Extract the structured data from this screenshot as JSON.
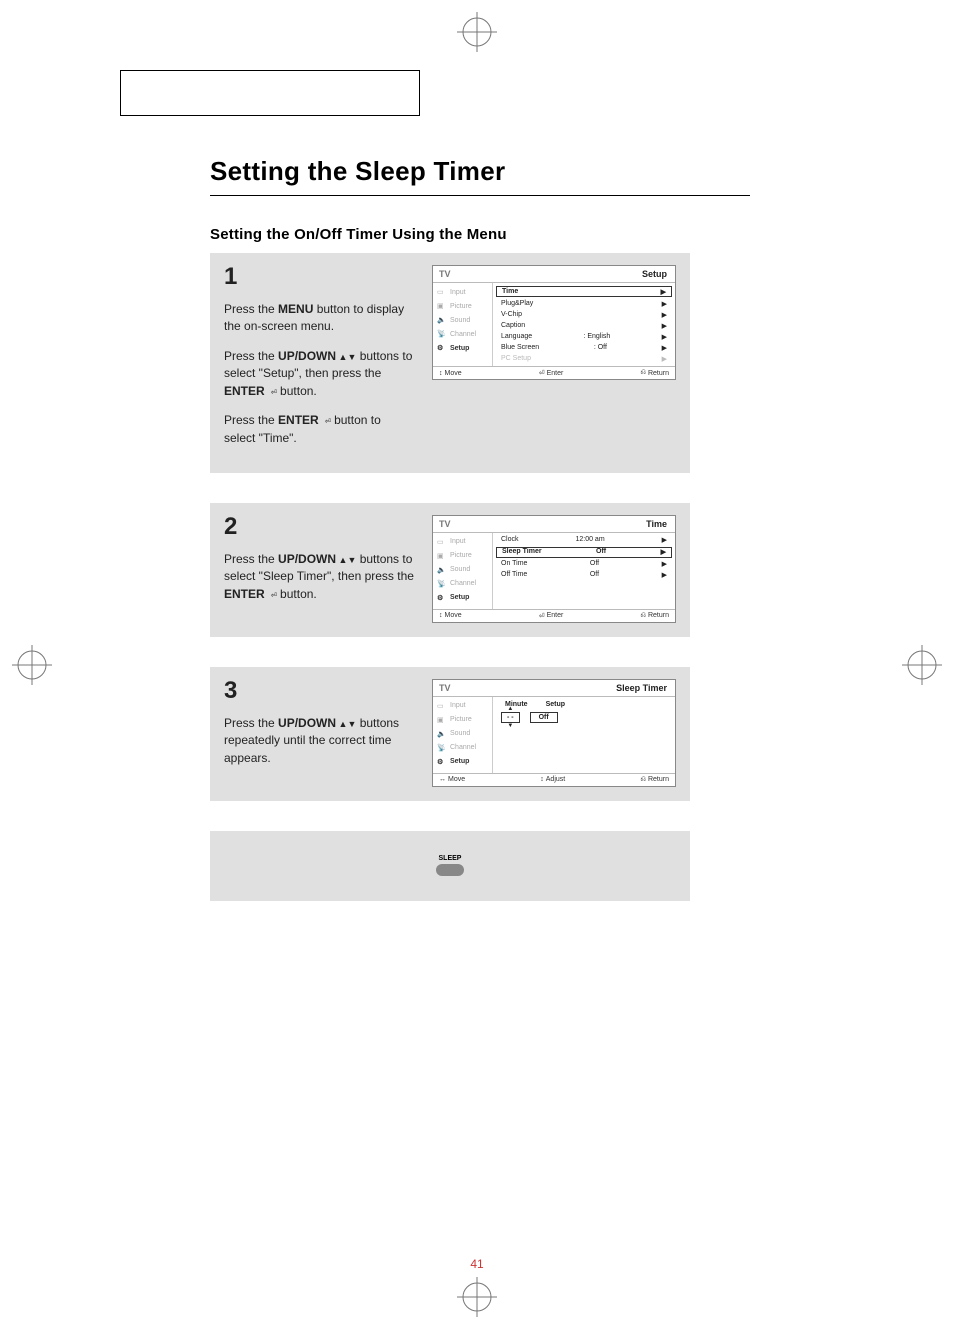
{
  "page_number": "41",
  "heading": "Setting the Sleep Timer",
  "subheading": "Setting the On/Off  Timer Using the Menu",
  "steps": {
    "s1": {
      "num": "1",
      "l1a": "Press the ",
      "l1b": "MENU",
      "l1c": " button to display the on-screen menu.",
      "l2a": "Press the ",
      "l2b": "UP/DOWN",
      "l2c": " buttons to select \"Setup\", then press the ",
      "l2d": "ENTER",
      "l2e": " button.",
      "l3a": "Press the ",
      "l3b": "ENTER",
      "l3c": " button to select \"Time\"."
    },
    "s2": {
      "num": "2",
      "l1a": "Press the ",
      "l1b": "UP/DOWN",
      "l1c": " buttons to select \"Sleep Timer\", then press the ",
      "l1d": "ENTER",
      "l1e": "  button."
    },
    "s3": {
      "num": "3",
      "l1a": "Press the ",
      "l1b": "UP/DOWN",
      "l1c": " buttons repeatedly until the correct time appears."
    }
  },
  "osd": {
    "tv": "TV",
    "side": {
      "input": "Input",
      "picture": "Picture",
      "sound": "Sound",
      "channel": "Channel",
      "setup": "Setup"
    },
    "footer": {
      "move_ud": "Move",
      "move_lr": "Move",
      "enter": "Enter",
      "adjust": "Adjust",
      "return": "Return"
    },
    "screen1": {
      "title": "Setup",
      "rows": {
        "time": "Time",
        "plugplay": "Plug&Play",
        "vchip": "V-Chip",
        "caption": "Caption",
        "language": "Language",
        "language_val": ":   English",
        "bluescreen": "Blue Screen",
        "bluescreen_val": ":   Off",
        "pcsetup": "PC Setup"
      }
    },
    "screen2": {
      "title": "Time",
      "rows": {
        "clock": "Clock",
        "clock_val": "12:00 am",
        "sleep": "Sleep Timer",
        "sleep_val": "Off",
        "ontime": "On Time",
        "ontime_val": "Off",
        "offtime": "Off Time",
        "offtime_val": "Off"
      }
    },
    "screen3": {
      "title": "Sleep Timer",
      "minute_h": "Minute",
      "setup_h": "Setup",
      "minute_v": "- -",
      "setup_v": "Off"
    }
  },
  "sleep_label": "SLEEP"
}
